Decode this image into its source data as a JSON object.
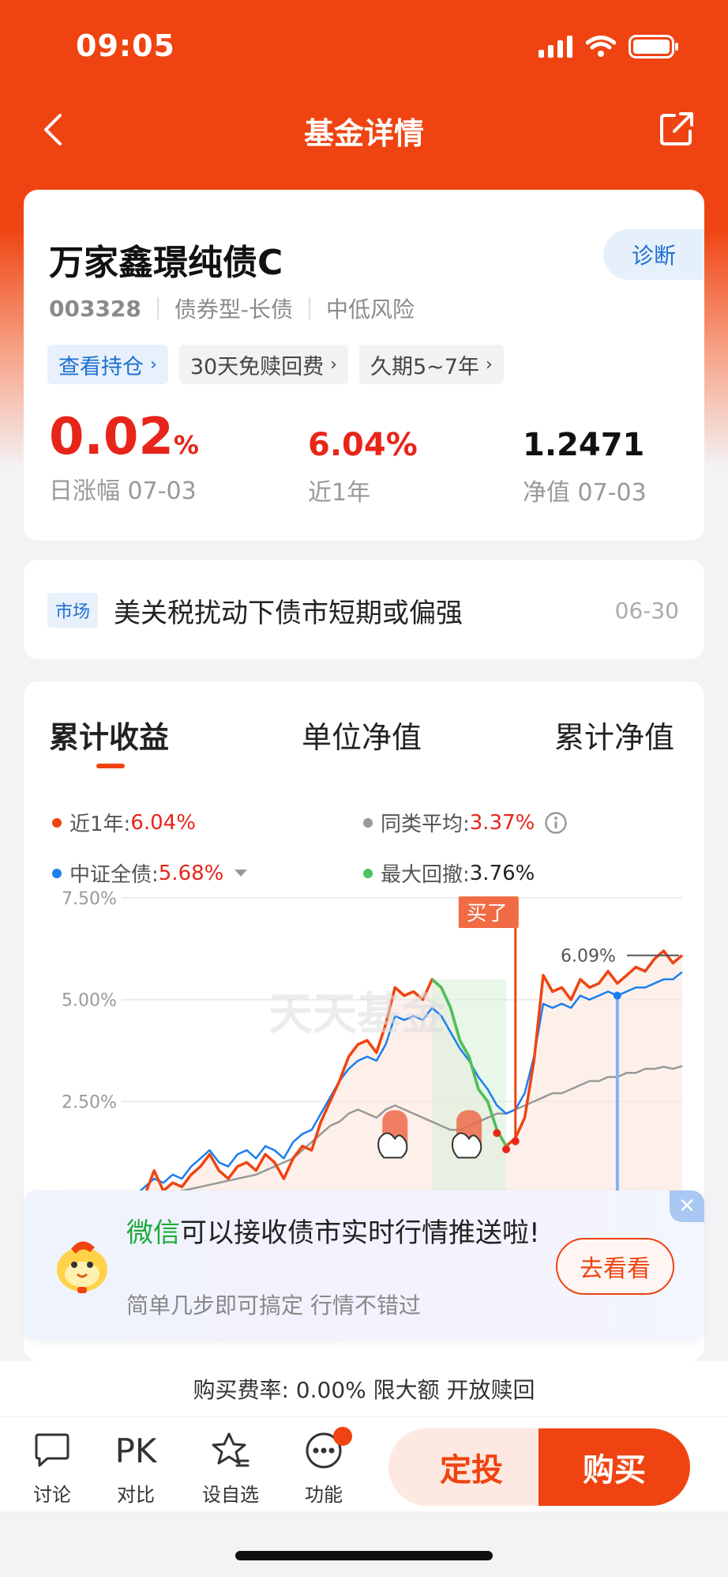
{
  "status": {
    "time": "09:05"
  },
  "nav": {
    "title": "基金详情"
  },
  "fund": {
    "name": "万家鑫璟纯债C",
    "diagnose_label": "诊断",
    "code": "003328",
    "type": "债券型-长债",
    "risk": "中低风险",
    "tags": [
      "查看持仓",
      "30天免赎回费",
      "久期5~7年"
    ],
    "daily_change_value": "0.02",
    "daily_change_unit": "%",
    "daily_change_label": "日涨幅 07-03",
    "year_return_value": "6.04%",
    "year_return_label": "近1年",
    "nav_value": "1.2471",
    "nav_label": "净值 07-03"
  },
  "news": {
    "tag": "市场",
    "text": "美关税扰动下债市短期或偏强",
    "date": "06-30"
  },
  "chart_tabs": [
    "累计收益",
    "单位净值",
    "累计净值"
  ],
  "legend": {
    "year_label": "近1年:",
    "year_value": "6.04%",
    "avg_label": "同类平均:",
    "avg_value": "3.37%",
    "index_label": "中证全债:",
    "index_value": "5.68%",
    "drawdown_label": "最大回撤:",
    "drawdown_value": "3.76%"
  },
  "chart_labels": {
    "buy_marker": "买了",
    "watermark": "天天基金",
    "end_value_label": "6.09%"
  },
  "chart_data": {
    "type": "line",
    "ylim": [
      0,
      7.5
    ],
    "yticks": [
      "7.50%",
      "5.00%",
      "2.50%"
    ],
    "x": [
      0,
      1,
      2,
      3,
      4,
      5,
      6,
      7,
      8,
      9,
      10,
      11,
      12,
      13,
      14,
      15,
      16,
      17,
      18,
      19,
      20,
      21,
      22,
      23,
      24,
      25,
      26,
      27,
      28,
      29,
      30,
      31,
      32,
      33,
      34,
      35,
      36,
      37,
      38,
      39,
      40,
      41,
      42,
      43,
      44,
      45,
      46,
      47,
      48,
      49,
      50,
      51,
      52,
      53,
      54,
      55,
      56,
      57,
      58,
      59,
      60
    ],
    "series": [
      {
        "color": "#ef4411",
        "values": [
          0,
          0.1,
          0.2,
          0.8,
          0.3,
          0.5,
          0.4,
          0.7,
          0.9,
          1.2,
          0.8,
          0.6,
          0.9,
          1.0,
          0.8,
          1.2,
          1.0,
          0.6,
          1.1,
          1.4,
          1.3,
          2.0,
          2.5,
          3.0,
          3.6,
          3.9,
          4.0,
          3.7,
          4.4,
          5.3,
          5.1,
          5.2,
          5.0,
          5.5,
          5.3,
          4.8,
          4.0,
          3.6,
          2.8,
          2.5,
          1.8,
          1.4,
          1.6,
          2.1,
          3.5,
          5.6,
          5.2,
          5.3,
          5.0,
          5.5,
          5.3,
          5.4,
          5.7,
          5.4,
          5.6,
          5.8,
          5.7,
          6.0,
          6.2,
          5.9,
          6.09
        ]
      },
      {
        "color": "#1a7ef0",
        "values": [
          0,
          0.2,
          0.4,
          0.6,
          0.5,
          0.7,
          0.6,
          0.9,
          1.1,
          1.3,
          1.0,
          0.9,
          1.2,
          1.3,
          1.1,
          1.4,
          1.3,
          1.1,
          1.5,
          1.7,
          1.8,
          2.2,
          2.6,
          3.0,
          3.3,
          3.5,
          3.6,
          3.5,
          3.9,
          4.6,
          4.5,
          4.6,
          4.5,
          4.8,
          4.6,
          4.2,
          3.8,
          3.5,
          3.1,
          2.8,
          2.4,
          2.2,
          2.3,
          2.7,
          3.6,
          4.9,
          4.8,
          4.9,
          4.8,
          5.1,
          5.0,
          5.1,
          5.2,
          5.1,
          5.2,
          5.3,
          5.3,
          5.4,
          5.5,
          5.5,
          5.68
        ]
      },
      {
        "color": "#999999",
        "values": [
          0,
          0.05,
          0.1,
          0.15,
          0.2,
          0.25,
          0.3,
          0.35,
          0.4,
          0.45,
          0.5,
          0.55,
          0.6,
          0.65,
          0.7,
          0.8,
          0.9,
          1.0,
          1.1,
          1.3,
          1.5,
          1.7,
          1.9,
          2.0,
          2.2,
          2.3,
          2.2,
          2.1,
          2.3,
          2.4,
          2.3,
          2.2,
          2.1,
          2.0,
          1.9,
          1.8,
          1.8,
          1.9,
          2.0,
          2.1,
          2.2,
          2.2,
          2.3,
          2.4,
          2.5,
          2.6,
          2.7,
          2.7,
          2.8,
          2.9,
          3.0,
          3.0,
          3.1,
          3.1,
          3.2,
          3.2,
          3.3,
          3.3,
          3.35,
          3.3,
          3.37
        ]
      }
    ]
  },
  "promo": {
    "title_highlight": "微信",
    "title_rest": "可以接收债市实时行情推送啦!",
    "subtitle": "简单几步即可搞定 行情不错过",
    "button": "去看看"
  },
  "fee_text": "购买费率: 0.00% 限大额 开放赎回",
  "bottom": {
    "discuss": "讨论",
    "pk_icon": "PK",
    "compare": "对比",
    "watchlist": "设自选",
    "features": "功能",
    "dingtou": "定投",
    "buy": "购买"
  }
}
